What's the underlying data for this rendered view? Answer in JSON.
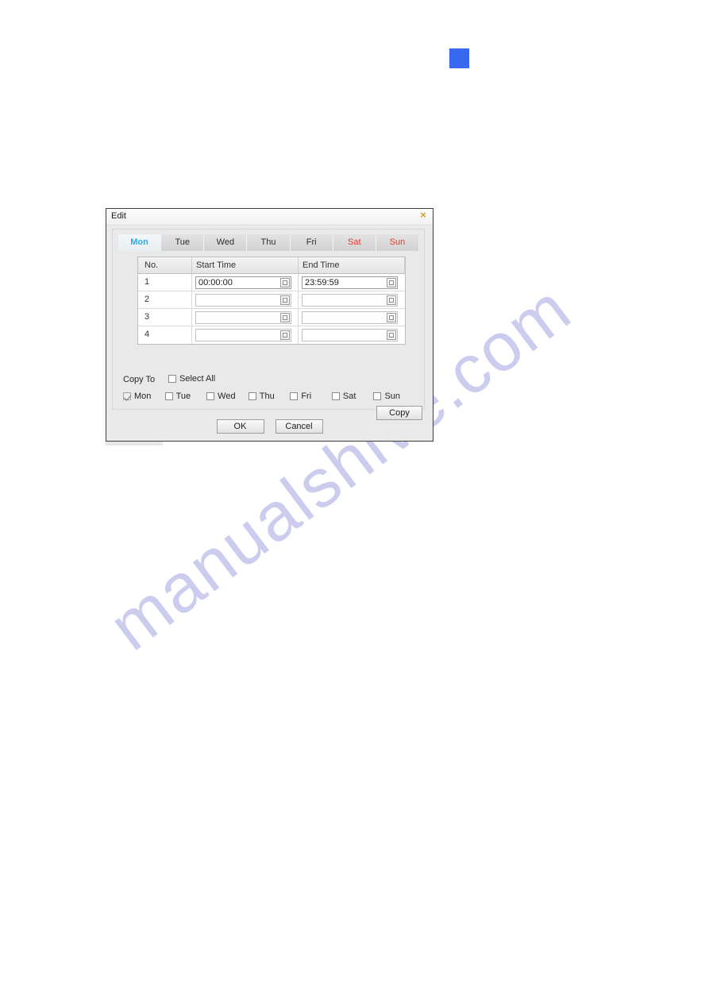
{
  "page": {
    "background_color": "#ffffff",
    "watermark_text": "manualshive.com",
    "watermark_color": "#ccccef",
    "marker_color": "#3768ef"
  },
  "dialog": {
    "title": "Edit",
    "close_icon": "close-icon",
    "accent_active_color": "#2aabe2",
    "weekend_color": "#e8392f",
    "tabs": [
      {
        "label": "Mon",
        "active": true,
        "weekend": false
      },
      {
        "label": "Tue",
        "active": false,
        "weekend": false
      },
      {
        "label": "Wed",
        "active": false,
        "weekend": false
      },
      {
        "label": "Thu",
        "active": false,
        "weekend": false
      },
      {
        "label": "Fri",
        "active": false,
        "weekend": false
      },
      {
        "label": "Sat",
        "active": false,
        "weekend": true
      },
      {
        "label": "Sun",
        "active": false,
        "weekend": true
      }
    ],
    "table": {
      "columns": [
        "No.",
        "Start Time",
        "End Time"
      ],
      "rows": [
        {
          "no": "1",
          "start_time": "00:00:00",
          "end_time": "23:59:59"
        },
        {
          "no": "2",
          "start_time": "",
          "end_time": ""
        },
        {
          "no": "3",
          "start_time": "",
          "end_time": ""
        },
        {
          "no": "4",
          "start_time": "",
          "end_time": ""
        }
      ],
      "picker_icon": "time-picker-icon"
    },
    "copy_to": {
      "label": "Copy To",
      "select_all": {
        "label": "Select All",
        "checked": false
      },
      "days": [
        {
          "label": "Mon",
          "checked": true,
          "disabled": true
        },
        {
          "label": "Tue",
          "checked": false,
          "disabled": false
        },
        {
          "label": "Wed",
          "checked": false,
          "disabled": false
        },
        {
          "label": "Thu",
          "checked": false,
          "disabled": false
        },
        {
          "label": "Fri",
          "checked": false,
          "disabled": false
        },
        {
          "label": "Sat",
          "checked": false,
          "disabled": false
        },
        {
          "label": "Sun",
          "checked": false,
          "disabled": false
        }
      ],
      "copy_button": "Copy"
    },
    "footer": {
      "ok": "OK",
      "cancel": "Cancel"
    }
  }
}
